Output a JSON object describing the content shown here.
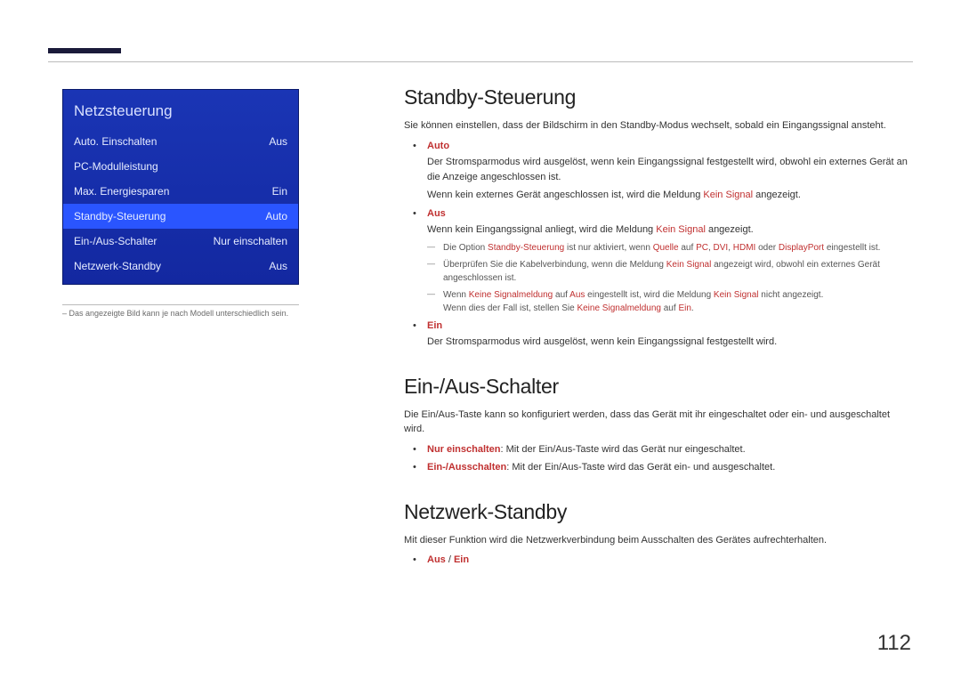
{
  "pageNumber": "112",
  "menu": {
    "title": "Netzsteuerung",
    "rows": [
      {
        "label": "Auto. Einschalten",
        "value": "Aus",
        "selected": false
      },
      {
        "label": "PC-Modulleistung",
        "value": "",
        "selected": false
      },
      {
        "label": "Max. Energiesparen",
        "value": "Ein",
        "selected": false
      },
      {
        "label": "Standby-Steuerung",
        "value": "Auto",
        "selected": true
      },
      {
        "label": "Ein-/Aus-Schalter",
        "value": "Nur einschalten",
        "selected": false
      },
      {
        "label": "Netzwerk-Standby",
        "value": "Aus",
        "selected": false
      }
    ],
    "note": "– Das angezeigte Bild kann je nach Modell unterschiedlich sein."
  },
  "sec1": {
    "title": "Standby-Steuerung",
    "intro": "Sie können einstellen, dass der Bildschirm in den Standby-Modus wechselt, sobald ein Eingangssignal ansteht.",
    "b1_label": "Auto",
    "b1_line1": "Der Stromsparmodus wird ausgelöst, wenn kein Eingangssignal festgestellt wird, obwohl ein externes Gerät an die Anzeige angeschlossen ist.",
    "b1_line2_a": "Wenn kein externes Gerät angeschlossen ist, wird die Meldung ",
    "b1_line2_ks": "Kein Signal",
    "b1_line2_b": " angezeigt.",
    "b2_label": "Aus",
    "b2_line1_a": "Wenn kein Eingangssignal anliegt, wird die Meldung ",
    "b2_line1_ks": "Kein Signal",
    "b2_line1_b": " angezeigt.",
    "d1_a": "Die Option ",
    "d1_ss": "Standby-Steuerung",
    "d1_b": " ist nur aktiviert, wenn ",
    "d1_q": "Quelle",
    "d1_c": " auf ",
    "d1_pc": "PC",
    "d1_d": ", ",
    "d1_dvi": "DVI",
    "d1_e": ", ",
    "d1_hdmi": "HDMI",
    "d1_f": " oder ",
    "d1_dp": "DisplayPort",
    "d1_g": " eingestellt ist.",
    "d2_a": "Überprüfen Sie die Kabelverbindung, wenn die Meldung ",
    "d2_ks": "Kein Signal",
    "d2_b": " angezeigt wird, obwohl ein externes Gerät angeschlossen ist.",
    "d3_a": "Wenn ",
    "d3_ksm1": "Keine Signalmeldung",
    "d3_b": " auf ",
    "d3_aus": "Aus",
    "d3_c": " eingestellt ist, wird die Meldung ",
    "d3_ks": "Kein Signal",
    "d3_d": " nicht angezeigt.",
    "d3_e": "Wenn dies der Fall ist, stellen Sie ",
    "d3_ksm2": "Keine Signalmeldung",
    "d3_f": " auf ",
    "d3_ein": "Ein",
    "d3_g": ".",
    "b3_label": "Ein",
    "b3_line1": "Der Stromsparmodus wird ausgelöst, wenn kein Eingangssignal festgestellt wird."
  },
  "sec2": {
    "title": "Ein-/Aus-Schalter",
    "intro": "Die Ein/Aus-Taste kann so konfiguriert werden, dass das Gerät mit ihr eingeschaltet oder ein- und ausgeschaltet wird.",
    "b1_lbl": "Nur einschalten",
    "b1_txt": ": Mit der Ein/Aus-Taste wird das Gerät nur eingeschaltet.",
    "b2_lbl": "Ein-/Ausschalten",
    "b2_txt": ": Mit der Ein/Aus-Taste wird das Gerät ein- und ausgeschaltet."
  },
  "sec3": {
    "title": "Netzwerk-Standby",
    "intro": "Mit dieser Funktion wird die Netzwerkverbindung beim Ausschalten des Gerätes aufrechterhalten.",
    "b_aus": "Aus",
    "b_slash": " / ",
    "b_ein": "Ein"
  }
}
